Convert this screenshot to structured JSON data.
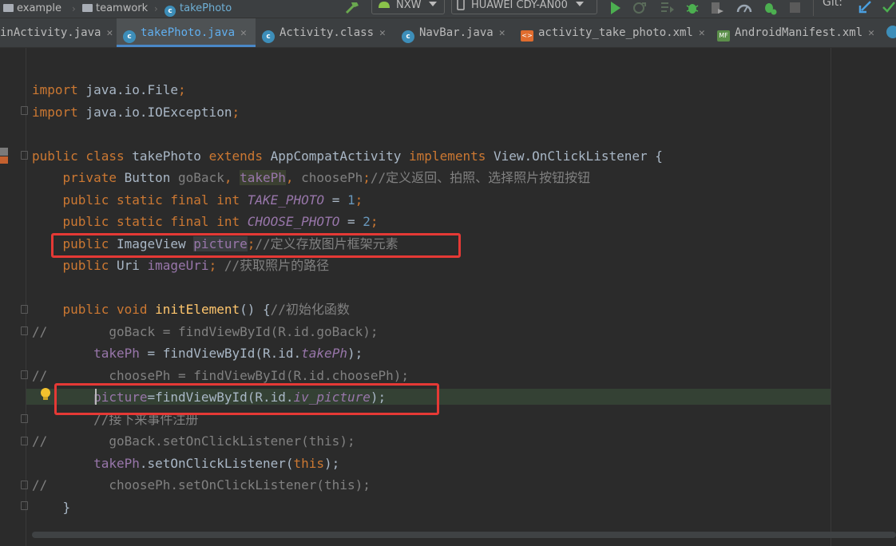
{
  "breadcrumb": {
    "items": [
      "example",
      "teamwork",
      "takePhoto"
    ]
  },
  "toolbar": {
    "config_combo": "NXW",
    "device_combo": "HUAWEI CDY-AN00",
    "git_label": "Git:"
  },
  "tabs": [
    {
      "label": "inActivity.java",
      "active": false,
      "icon": "class-icon"
    },
    {
      "label": "takePhoto.java",
      "active": true,
      "icon": "class-icon"
    },
    {
      "label": "Activity.class",
      "active": false,
      "icon": "class-icon"
    },
    {
      "label": "NavBar.java",
      "active": false,
      "icon": "class-icon"
    },
    {
      "label": "activity_take_photo.xml",
      "active": false,
      "icon": "xml-icon"
    },
    {
      "label": "AndroidManifest.xml",
      "active": false,
      "icon": "manifest-icon"
    }
  ],
  "code": {
    "l1": {
      "kw": "import",
      "rest": " java.io.File",
      "semi": ";"
    },
    "l2": {
      "kw": "import",
      "rest": " java.io.IOException",
      "semi": ";"
    },
    "l3": {
      "kw1": "public class",
      "name": " takePhoto ",
      "kw2": "extends",
      "base": " AppCompatActivity ",
      "kw3": "implements",
      "iface": " View.OnClickListener {"
    },
    "l4": {
      "kw": "    private",
      "type": " Button ",
      "f1": "goBack",
      "c1": ", ",
      "f2": "takePh",
      "c2": ", ",
      "f3": "choosePh",
      "semi": ";",
      "comment": "//定义返回、拍照、选择照片按钮按钮"
    },
    "l5": {
      "kw": "    public static final int",
      "sp": " ",
      "name": "TAKE_PHOTO",
      "eq": " = ",
      "val": "1",
      "semi": ";"
    },
    "l6": {
      "kw": "    public static final int",
      "sp": " ",
      "name": "CHOOSE_PHOTO",
      "eq": " = ",
      "val": "2",
      "semi": ";"
    },
    "l7": {
      "kw": "    public",
      "type": " ImageView ",
      "field": "picture",
      "semi": ";",
      "comment": "//定义存放图片框架元素"
    },
    "l8": {
      "kw": "    public",
      "type": " Uri ",
      "field": "imageUri",
      "semi": ";",
      "comment": " //获取照片的路径"
    },
    "l9": {
      "kw": "    public void",
      "sp": " ",
      "fn": "initElement",
      "rest": "() {",
      "comment": "//初始化函数"
    },
    "l10": {
      "text": "//        goBack = findViewById(R.id.goBack);"
    },
    "l11": {
      "field": "        takePh",
      "mid": " = findViewById(R.id.",
      "it": "takePh",
      "end": ");"
    },
    "l12": {
      "text": "//        choosePh = findViewById(R.id.choosePh);"
    },
    "l13": {
      "field": "        picture",
      "mid": "=findViewById(R.id.",
      "it": "iv_picture",
      "end": ");"
    },
    "l14": {
      "text": "        //接下来事件注册"
    },
    "l15": {
      "text": "//        goBack.setOnClickListener(this);"
    },
    "l16": {
      "field": "        takePh",
      "mid": ".setOnClickListener(",
      "kw": "this",
      "end": ");"
    },
    "l17": {
      "text": "//        choosePh.setOnClickListener(this);"
    },
    "l18": {
      "text": "    }"
    }
  },
  "colors": {
    "keyword": "#cc7832",
    "field": "#9876aa",
    "comment": "#808080",
    "number": "#6897bb",
    "method": "#ffc66d",
    "annotation_box": "#e53935"
  }
}
